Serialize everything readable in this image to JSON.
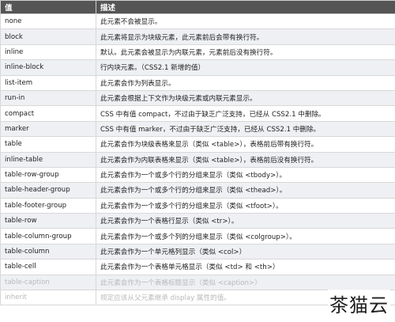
{
  "table": {
    "headers": [
      "值",
      "描述"
    ],
    "rows": [
      {
        "value": "none",
        "desc": "此元素不会被显示。"
      },
      {
        "value": "block",
        "desc": "此元素将显示为块级元素，此元素前后会带有换行符。"
      },
      {
        "value": "inline",
        "desc": "默认。此元素会被显示为内联元素，元素前后没有换行符。"
      },
      {
        "value": "inline-block",
        "desc": "行内块元素。（CSS2.1 新增的值）"
      },
      {
        "value": "list-item",
        "desc": "此元素会作为列表显示。"
      },
      {
        "value": "run-in",
        "desc": "此元素会根据上下文作为块级元素或内联元素显示。"
      },
      {
        "value": "compact",
        "desc": "CSS 中有值 compact，不过由于缺乏广泛支持，已经从 CSS2.1 中删除。"
      },
      {
        "value": "marker",
        "desc": "CSS 中有值 marker，不过由于缺乏广泛支持，已经从 CSS2.1 中删除。"
      },
      {
        "value": "table",
        "desc": "此元素会作为块级表格来显示（类似 <table>），表格前后带有换行符。"
      },
      {
        "value": "inline-table",
        "desc": "此元素会作为内联表格来显示（类似 <table>），表格前后没有换行符。"
      },
      {
        "value": "table-row-group",
        "desc": "此元素会作为一个或多个行的分组来显示（类似 <tbody>）。"
      },
      {
        "value": "table-header-group",
        "desc": "此元素会作为一个或多个行的分组来显示（类似 <thead>）。"
      },
      {
        "value": "table-footer-group",
        "desc": "此元素会作为一个或多个行的分组来显示（类似 <tfoot>）。"
      },
      {
        "value": "table-row",
        "desc": "此元素会作为一个表格行显示（类似 <tr>）。"
      },
      {
        "value": "table-column-group",
        "desc": "此元素会作为一个或多个列的分组来显示（类似 <colgroup>）。"
      },
      {
        "value": "table-column",
        "desc": "此元素会作为一个单元格列显示（类似 <col>）"
      },
      {
        "value": "table-cell",
        "desc": "此元素会作为一个表格单元格显示（类似 <td> 和 <th>）"
      },
      {
        "value": "table-caption",
        "desc": "此元素会作为一个表格标题显示（类似 <caption>）"
      },
      {
        "value": "inherit",
        "desc": "规定应该从父元素继承 display 属性的值。"
      }
    ]
  },
  "watermark": "茶猫云",
  "colors": {
    "header_bg": "#555555",
    "header_text": "#ffffff",
    "row_alt": "#eef0f3",
    "border": "#d8d8d8"
  }
}
